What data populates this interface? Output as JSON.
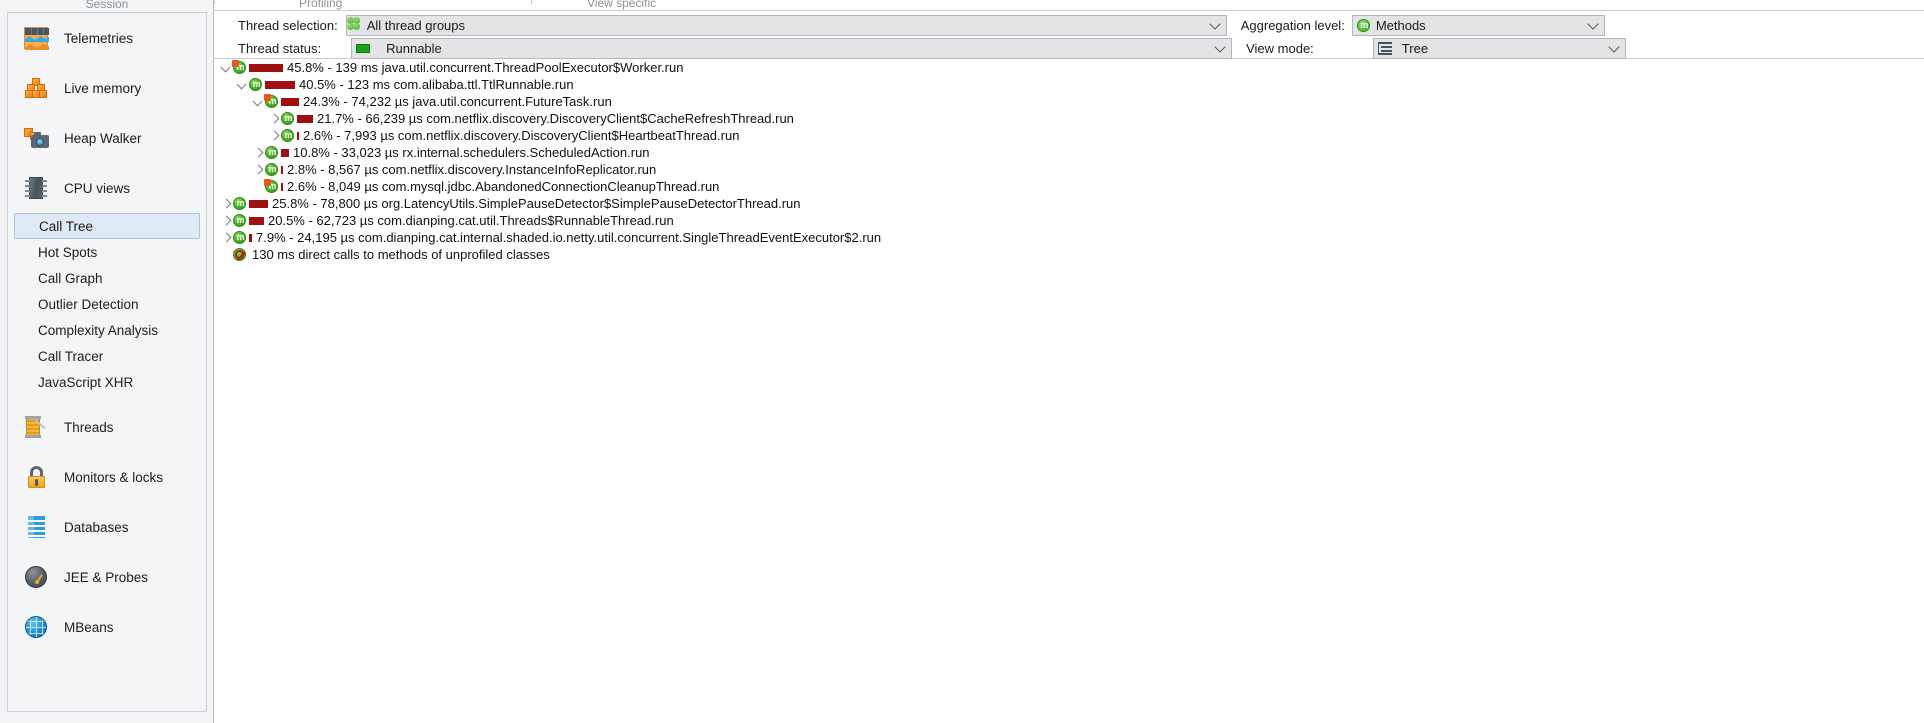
{
  "sidebar": {
    "top_caption": "Session",
    "major_items": [
      {
        "label": "Telemetries",
        "icon": "telemetries-icon"
      },
      {
        "label": "Live memory",
        "icon": "live-memory-icon"
      },
      {
        "label": "Heap Walker",
        "icon": "heap-walker-icon"
      },
      {
        "label": "CPU views",
        "icon": "cpu-views-icon"
      }
    ],
    "cpu_subitems": [
      {
        "label": "Call Tree",
        "selected": true
      },
      {
        "label": "Hot Spots",
        "selected": false
      },
      {
        "label": "Call Graph",
        "selected": false
      },
      {
        "label": "Outlier Detection",
        "selected": false
      },
      {
        "label": "Complexity Analysis",
        "selected": false
      },
      {
        "label": "Call Tracer",
        "selected": false
      },
      {
        "label": "JavaScript XHR",
        "selected": false
      }
    ],
    "major_items_bottom": [
      {
        "label": "Threads",
        "icon": "threads-icon"
      },
      {
        "label": "Monitors & locks",
        "icon": "monitors-locks-icon"
      },
      {
        "label": "Databases",
        "icon": "databases-icon"
      },
      {
        "label": "JEE & Probes",
        "icon": "jee-probes-icon"
      },
      {
        "label": "MBeans",
        "icon": "mbeans-icon"
      }
    ]
  },
  "toolbar": {
    "caption_profiling": "Profiling",
    "caption_view_specific": "View specific"
  },
  "filters": {
    "thread_selection_label": "Thread selection:",
    "thread_selection_value": "All thread groups",
    "thread_selection_icon": "thread-groups-icon",
    "thread_status_label": "Thread status:",
    "thread_status_value": "Runnable",
    "thread_status_icon": "runnable-status-icon",
    "aggregation_label": "Aggregation level:",
    "aggregation_value": "Methods",
    "aggregation_icon": "methods-icon",
    "view_mode_label": "View mode:",
    "view_mode_value": "Tree",
    "view_mode_icon": "tree-icon"
  },
  "colors": {
    "bar_red": "#9e0f0f",
    "selection_blue": "#dfeaf5",
    "method_green": "#3bb01c",
    "runnable_green": "#19a319"
  },
  "call_tree": {
    "rows": [
      {
        "depth": 0,
        "twist": "open",
        "icon": "method-icon-flagged",
        "bar": 34,
        "percent": "45.8%",
        "sep": "-",
        "time": "139 ms",
        "method": "java.util.concurrent.ThreadPoolExecutor$Worker.run"
      },
      {
        "depth": 1,
        "twist": "open",
        "icon": "method-icon",
        "bar": 30,
        "percent": "40.5%",
        "sep": "-",
        "time": "123 ms",
        "method": "com.alibaba.ttl.TtlRunnable.run"
      },
      {
        "depth": 2,
        "twist": "open",
        "icon": "method-icon-flagged",
        "bar": 18,
        "percent": "24.3%",
        "sep": "-",
        "time": "74,232 µs",
        "method": "java.util.concurrent.FutureTask.run"
      },
      {
        "depth": 3,
        "twist": "closed",
        "icon": "method-icon",
        "bar": 16,
        "percent": "21.7%",
        "sep": "-",
        "time": "66,239 µs",
        "method": "com.netflix.discovery.DiscoveryClient$CacheRefreshThread.run"
      },
      {
        "depth": 3,
        "twist": "closed",
        "icon": "method-icon",
        "bar": 2,
        "percent": "2.6%",
        "sep": "-",
        "time": "7,993 µs",
        "method": "com.netflix.discovery.DiscoveryClient$HeartbeatThread.run"
      },
      {
        "depth": 2,
        "twist": "closed",
        "icon": "method-icon",
        "bar": 8,
        "percent": "10.8%",
        "sep": "-",
        "time": "33,023 µs",
        "method": "rx.internal.schedulers.ScheduledAction.run"
      },
      {
        "depth": 2,
        "twist": "closed",
        "icon": "method-icon",
        "bar": 2,
        "percent": "2.8%",
        "sep": "-",
        "time": "8,567 µs",
        "method": "com.netflix.discovery.InstanceInfoReplicator.run"
      },
      {
        "depth": 2,
        "twist": "none",
        "icon": "method-icon-flagged",
        "bar": 2,
        "percent": "2.6%",
        "sep": "-",
        "time": "8,049 µs",
        "method": "com.mysql.jdbc.AbandonedConnectionCleanupThread.run"
      },
      {
        "depth": 0,
        "twist": "closed",
        "icon": "method-icon",
        "bar": 19,
        "percent": "25.8%",
        "sep": "-",
        "time": "78,800 µs",
        "method": "org.LatencyUtils.SimplePauseDetector$SimplePauseDetectorThread.run"
      },
      {
        "depth": 0,
        "twist": "closed",
        "icon": "method-icon",
        "bar": 15,
        "percent": "20.5%",
        "sep": "-",
        "time": "62,723 µs",
        "method": "com.dianping.cat.util.Threads$RunnableThread.run"
      },
      {
        "depth": 0,
        "twist": "closed",
        "icon": "method-icon",
        "bar": 3,
        "percent": "7.9%",
        "sep": "-",
        "time": "24,195 µs",
        "method": "com.dianping.cat.internal.shaded.io.netty.util.concurrent.SingleThreadEventExecutor$2.run"
      },
      {
        "depth": 0,
        "twist": "none",
        "icon": "unprofiled-icon",
        "bar": 0,
        "percent": "",
        "sep": "",
        "time": "130 ms",
        "method": "direct calls to methods of unprofiled classes"
      }
    ]
  }
}
